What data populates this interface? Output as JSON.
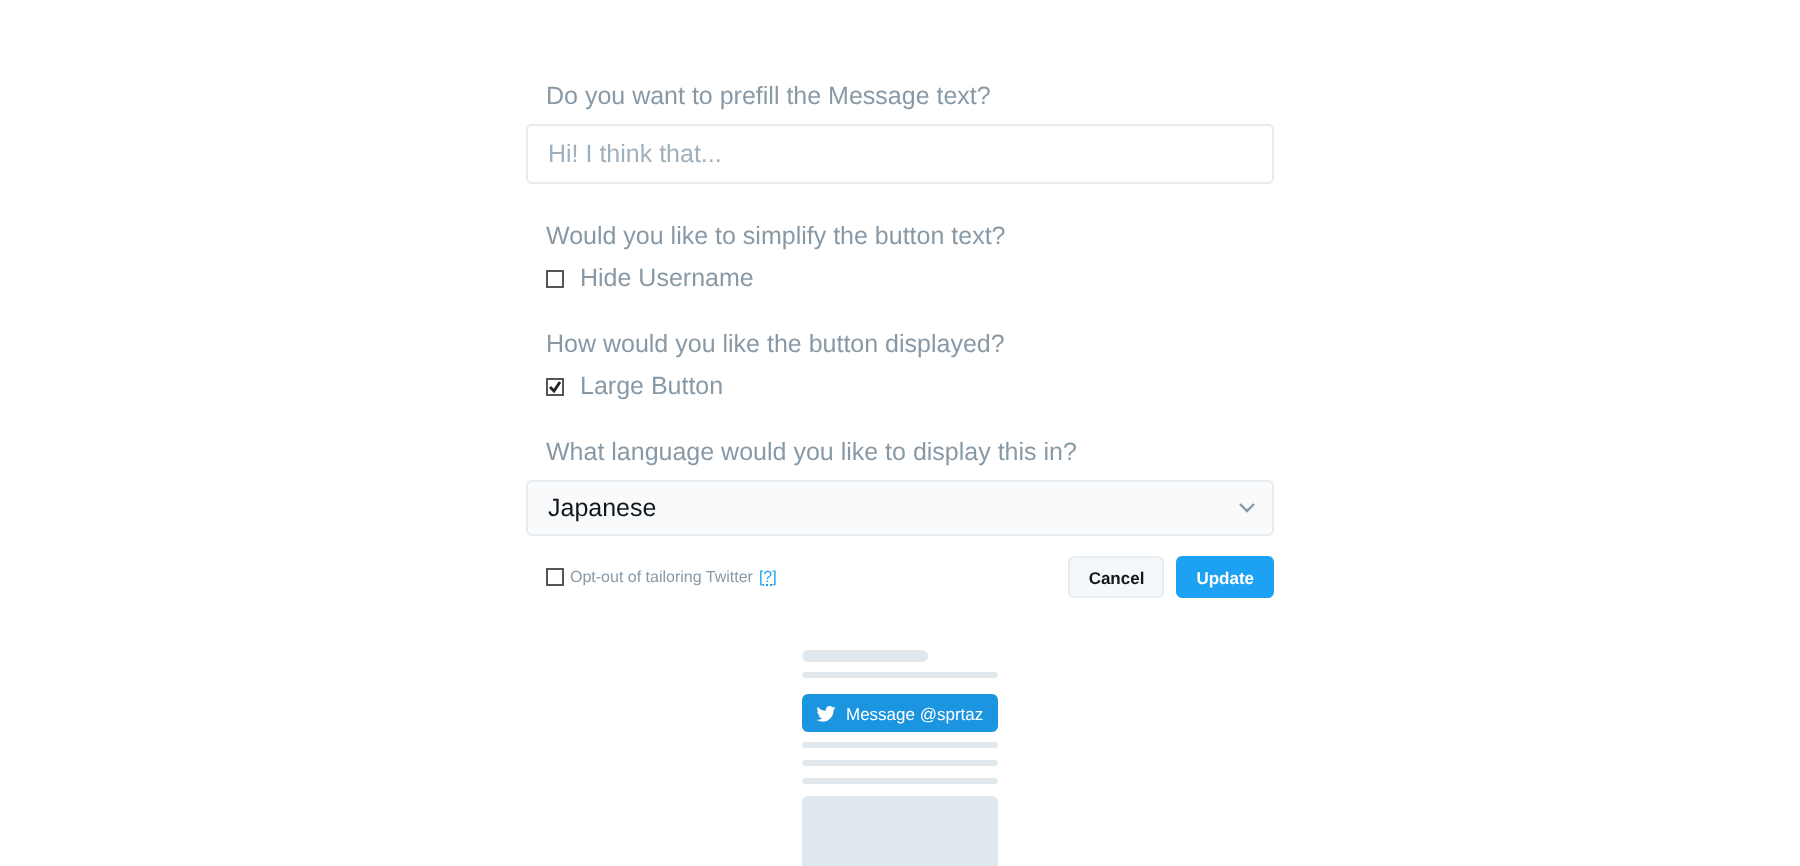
{
  "prefill": {
    "question": "Do you want to prefill the Message text?",
    "placeholder": "Hi! I think that..."
  },
  "options": [
    {
      "question": "Would you like to simplify the button text?",
      "label": "Hide Username",
      "checked": false
    },
    {
      "question": "How would you like the button displayed?",
      "label": "Large Button",
      "checked": true
    }
  ],
  "language": {
    "question": "What language would you like to display this in?",
    "value": "Japanese"
  },
  "opt_out": {
    "label": "Opt-out of tailoring Twitter",
    "help": "[?]",
    "checked": false
  },
  "buttons": [
    {
      "label": "Cancel",
      "kind": "secondary"
    },
    {
      "label": "Update",
      "kind": "primary"
    }
  ],
  "preview": {
    "button": "Message @sprtaz"
  }
}
